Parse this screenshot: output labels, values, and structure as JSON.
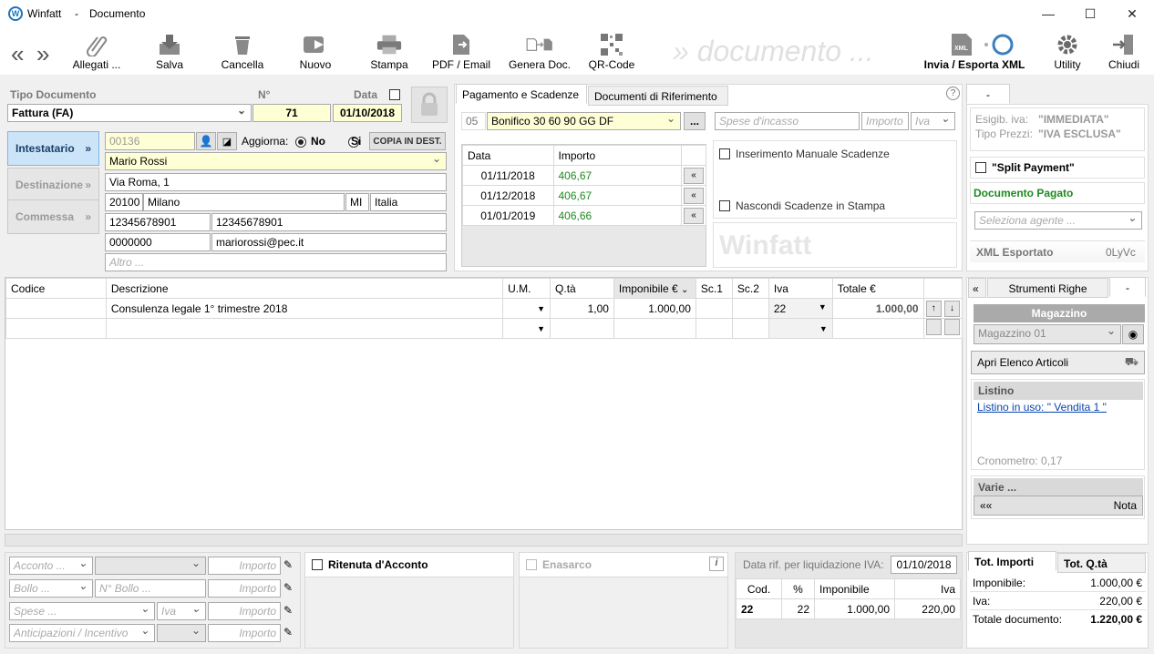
{
  "window": {
    "app": "Winfatt",
    "sep": "-",
    "doc": "Documento",
    "logo_glyph": "W",
    "minimize": "—",
    "maximize": "☐",
    "close": "✕"
  },
  "toolbar": {
    "nav_prev": "«",
    "nav_next": "»",
    "allegati": "Allegati ...",
    "salva": "Salva",
    "cancella": "Cancella",
    "nuovo": "Nuovo",
    "stampa": "Stampa",
    "pdf": "PDF / Email",
    "genera": "Genera Doc.",
    "qr": "QR-Code",
    "ghost": "» documento ...",
    "invia": "Invia / Esporta XML",
    "xml_badge": "XML",
    "utility": "Utility",
    "chiudi": "Chiudi"
  },
  "header": {
    "tipo_label": "Tipo Documento",
    "num_label": "N°",
    "data_label": "Data",
    "tipo_value": "Fattura  (FA)",
    "num_value": "71",
    "data_value": "01/10/2018"
  },
  "side": {
    "intestatario": "Intestatario",
    "destinazione": "Destinazione",
    "commessa": "Commessa",
    "arrow": "»"
  },
  "customer": {
    "code": "00136",
    "aggiorna": "Aggiorna:",
    "no": "No",
    "si": "Si",
    "copia": "COPIA IN DEST.",
    "name": "Mario Rossi",
    "address": "Via Roma, 1",
    "cap": "20100",
    "city": "Milano",
    "prov": "MI",
    "country": "Italia",
    "piva": "12345678901",
    "cf": "12345678901",
    "sdi": "0000000",
    "pec": "mariorossi@pec.it",
    "altro": "Altro ..."
  },
  "payment": {
    "tab1": "Pagamento e Scadenze",
    "tab2": "Documenti di Riferimento",
    "help": "?",
    "code": "05",
    "method": "Bonifico 30 60 90 GG DF",
    "more": "...",
    "spese_ph": "Spese d'incasso",
    "importo_ph": "Importo",
    "iva_ph": "Iva",
    "col_data": "Data",
    "col_importo": "Importo",
    "rows": [
      {
        "data": "01/11/2018",
        "importo": "406,67",
        "btn": "«"
      },
      {
        "data": "01/12/2018",
        "importo": "406,67",
        "btn": "«"
      },
      {
        "data": "01/01/2019",
        "importo": "406,66",
        "btn": "«"
      }
    ],
    "manuale": "Inserimento Manuale Scadenze",
    "nascondi": "Nascondi Scadenze in Stampa",
    "watermark": "Winfatt"
  },
  "right": {
    "tab": "-",
    "esigib_label": "Esigib. iva:",
    "esigib_value": "\"IMMEDIATA\"",
    "tipo_prezzi_label": "Tipo Prezzi:",
    "tipo_prezzi_value": "\"IVA ESCLUSA\"",
    "split": "\"Split Payment\"",
    "pagato": "Documento Pagato",
    "agente_ph": "Seleziona agente ...",
    "xml_label": "XML Esportato",
    "xml_value": "0LyVc"
  },
  "lines": {
    "headers": [
      "Codice",
      "Descrizione",
      "U.M.",
      "Q.tà",
      "Imponibile €",
      "Sc.1",
      "Sc.2",
      "Iva",
      "Totale €"
    ],
    "row1": {
      "codice": "",
      "descrizione": "Consulenza legale 1° trimestre 2018",
      "qta": "1,00",
      "imponibile": "1.000,00",
      "iva": "22",
      "totale": "1.000,00"
    },
    "up": "↑",
    "down": "↓"
  },
  "tools": {
    "nav": "«",
    "tab": "Strumenti Righe",
    "tab2": "-",
    "magazzino_header": "Magazzino",
    "magazzino_value": "Magazzino 01",
    "apri": "Apri Elenco Articoli",
    "listino_header": "Listino",
    "listino_link": "Listino in uso: \" Vendita 1 \"",
    "crono": "Cronometro: 0,17",
    "varie_header": "Varie ...",
    "varie_nav": "««",
    "nota": "Nota"
  },
  "bottom": {
    "acconto_ph": "Acconto ...",
    "bollo_ph": "Bollo ...",
    "nbollo_ph": "N° Bollo ...",
    "spese_ph": "Spese ...",
    "iva_ph": "Iva",
    "anticip_ph": "Anticipazioni / Incentivo",
    "importo_ph": "Importo",
    "ritenuta": "Ritenuta d'Acconto",
    "enasarco": "Enasarco",
    "info": "i",
    "data_rif_label": "Data rif. per liquidazione IVA:",
    "data_rif": "01/10/2018",
    "iva_cols": [
      "Cod.",
      "%",
      "Imponibile",
      "Iva"
    ],
    "iva_row": {
      "cod": "22",
      "perc": "22",
      "imponibile": "1.000,00",
      "iva": "220,00"
    }
  },
  "totals": {
    "tab1": "Tot. Importi",
    "tab2": "Tot. Q.tà",
    "imponibile_label": "Imponibile:",
    "imponibile": "1.000,00 €",
    "iva_label": "Iva:",
    "iva": "220,00 €",
    "totale_label": "Totale documento:",
    "totale": "1.220,00 €"
  }
}
